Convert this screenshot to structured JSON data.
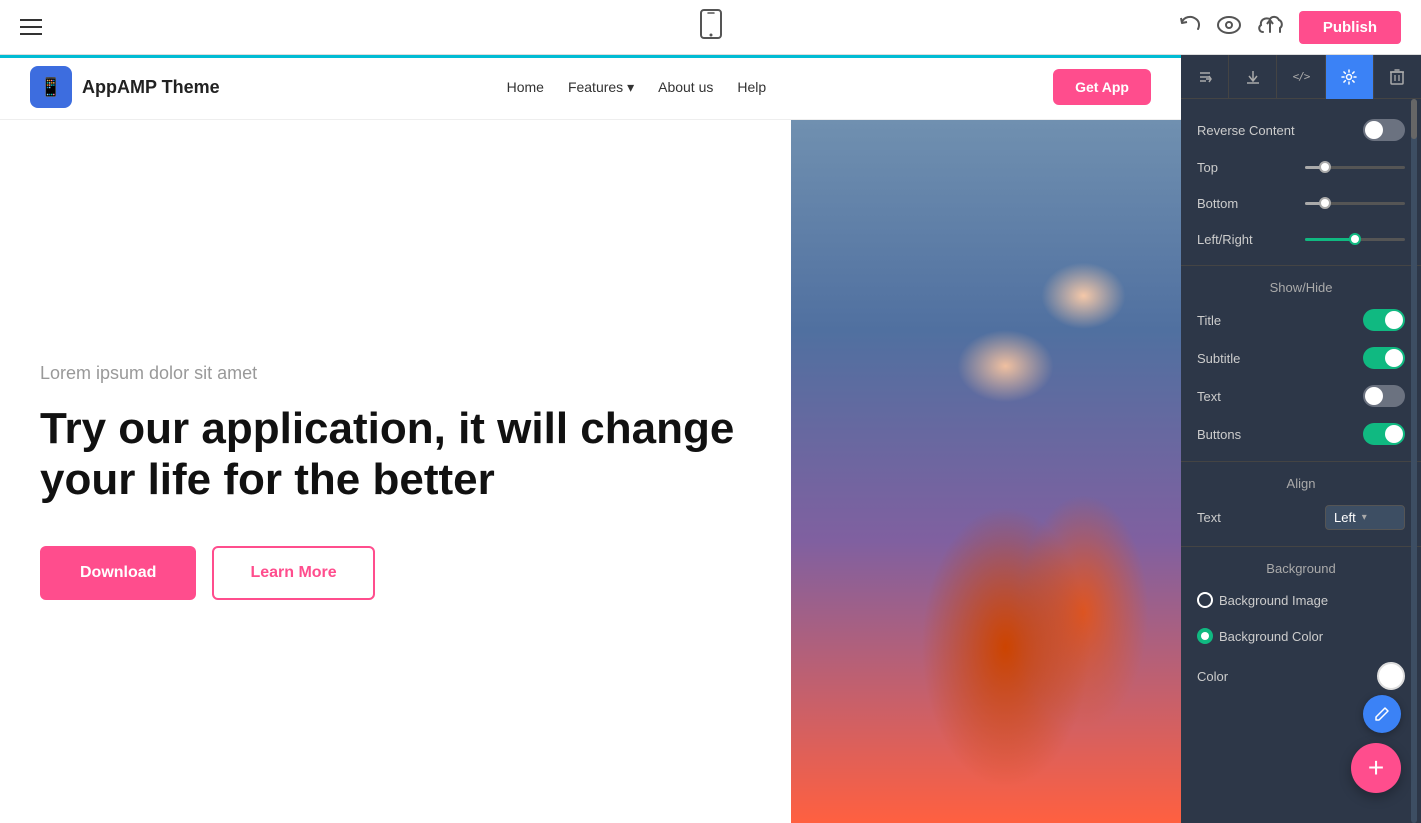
{
  "toolbar": {
    "publish_label": "Publish",
    "phone_icon": "📱"
  },
  "nav": {
    "logo_icon": "📱",
    "logo_text": "AppAMP Theme",
    "links": [
      {
        "label": "Home"
      },
      {
        "label": "Features ▾"
      },
      {
        "label": "About us"
      },
      {
        "label": "Help"
      }
    ],
    "cta_label": "Get App"
  },
  "hero": {
    "subtitle": "Lorem ipsum dolor sit amet",
    "title": "Try our application, it will change your life for the better",
    "btn_download": "Download",
    "btn_learn_more": "Learn More"
  },
  "settings": {
    "reverse_content_label": "Reverse Content",
    "reverse_content_on": false,
    "top_label": "Top",
    "bottom_label": "Bottom",
    "left_right_label": "Left/Right",
    "show_hide_label": "Show/Hide",
    "title_label": "Title",
    "title_on": true,
    "subtitle_label": "Subtitle",
    "subtitle_on": true,
    "text_label": "Text",
    "text_on": false,
    "buttons_label": "Buttons",
    "buttons_on": true,
    "align_label": "Align",
    "text_align_label": "Text",
    "text_align_value": "Left",
    "background_label": "Background",
    "background_image_label": "Background Image",
    "background_image_checked": false,
    "background_color_label": "Background Color",
    "background_color_checked": true,
    "color_label": "Color",
    "sliders": {
      "top_percent": 20,
      "bottom_percent": 20,
      "left_right_percent": 50
    }
  },
  "icons": {
    "hamburger": "☰",
    "undo": "↩",
    "eye": "👁",
    "cloud": "⬆",
    "sort": "⇅",
    "download": "⬇",
    "code": "</>",
    "gear": "⚙",
    "trash": "🗑",
    "edit": "✏",
    "add": "+"
  }
}
